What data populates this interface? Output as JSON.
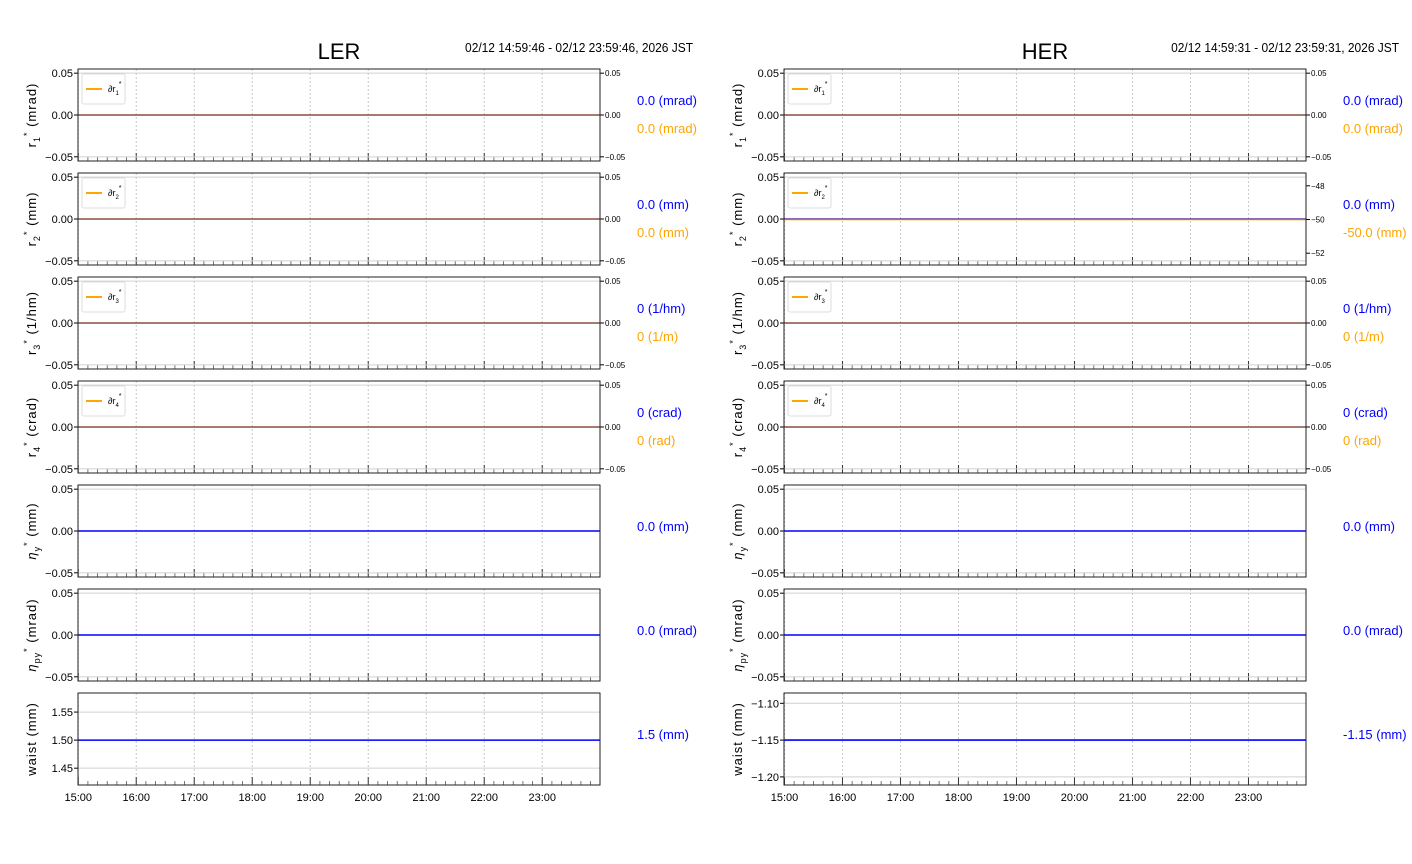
{
  "colors": {
    "blue": "#0000ff",
    "orange": "#ffa500",
    "red_trace": "#d9534f",
    "axis": "#000000",
    "grid": "#c8c8c8"
  },
  "chart_data": [
    {
      "type": "line",
      "title": "LER",
      "time_range_label": "02/12 14:59:46 - 02/12 23:59:46, 2026 JST",
      "x_ticks": [
        "15:00",
        "16:00",
        "17:00",
        "18:00",
        "19:00",
        "20:00",
        "21:00",
        "22:00",
        "23:00"
      ],
      "xlim_hours": [
        14.9961,
        23.9961
      ],
      "panels": [
        {
          "ylabel_main": "r",
          "ylabel_sub": "1",
          "ylabel_unit": " (mrad)",
          "ylim": [
            -0.055,
            0.055
          ],
          "yticks": [
            "0.05",
            "0.00",
            "−0.05"
          ],
          "ytick_values": [
            0.05,
            0,
            -0.05
          ],
          "legend": "∂r",
          "legend_sub": "1",
          "right_ylim": [
            -0.055,
            0.055
          ],
          "right_ticks": [
            "0.05",
            "0.00",
            "−0.05"
          ],
          "right_tick_values": [
            0.05,
            0,
            -0.05
          ],
          "series": [
            {
              "name": "r1*",
              "color": "#0000ff",
              "value": 0.0
            },
            {
              "name": "∂r1*",
              "color": "#ffa500",
              "value": 0.0,
              "axis": "right"
            }
          ],
          "readouts": [
            {
              "text": "0.0 (mrad)",
              "color": "#0000ff"
            },
            {
              "text": "0.0 (mrad)",
              "color": "#ffa500"
            }
          ]
        },
        {
          "ylabel_main": "r",
          "ylabel_sub": "2",
          "ylabel_unit": " (mm)",
          "ylim": [
            -0.055,
            0.055
          ],
          "yticks": [
            "0.05",
            "0.00",
            "−0.05"
          ],
          "ytick_values": [
            0.05,
            0,
            -0.05
          ],
          "legend": "∂r",
          "legend_sub": "2",
          "right_ylim": [
            -0.055,
            0.055
          ],
          "right_ticks": [
            "0.05",
            "0.00",
            "−0.05"
          ],
          "right_tick_values": [
            0.05,
            0,
            -0.05
          ],
          "series": [
            {
              "name": "r2*",
              "color": "#0000ff",
              "value": 0.0
            },
            {
              "name": "∂r2*",
              "color": "#ffa500",
              "value": 0.0,
              "axis": "right"
            }
          ],
          "readouts": [
            {
              "text": "0.0 (mm)",
              "color": "#0000ff"
            },
            {
              "text": "0.0 (mm)",
              "color": "#ffa500"
            }
          ]
        },
        {
          "ylabel_main": "r",
          "ylabel_sub": "3",
          "ylabel_unit": " (1/hm)",
          "ylim": [
            -0.055,
            0.055
          ],
          "yticks": [
            "0.05",
            "0.00",
            "−0.05"
          ],
          "ytick_values": [
            0.05,
            0,
            -0.05
          ],
          "legend": "∂r",
          "legend_sub": "3",
          "right_ylim": [
            -0.055,
            0.055
          ],
          "right_ticks": [
            "0.05",
            "0.00",
            "−0.05"
          ],
          "right_tick_values": [
            0.05,
            0,
            -0.05
          ],
          "series": [
            {
              "name": "r3*",
              "color": "#0000ff",
              "value": 0
            },
            {
              "name": "∂r3*",
              "color": "#ffa500",
              "value": 0,
              "axis": "right"
            }
          ],
          "readouts": [
            {
              "text": "0 (1/hm)",
              "color": "#0000ff"
            },
            {
              "text": "0 (1/m)",
              "color": "#ffa500"
            }
          ]
        },
        {
          "ylabel_main": "r",
          "ylabel_sub": "4",
          "ylabel_unit": " (crad)",
          "ylim": [
            -0.055,
            0.055
          ],
          "yticks": [
            "0.05",
            "0.00",
            "−0.05"
          ],
          "ytick_values": [
            0.05,
            0,
            -0.05
          ],
          "legend": "∂r",
          "legend_sub": "4",
          "right_ylim": [
            -0.055,
            0.055
          ],
          "right_ticks": [
            "0.05",
            "0.00",
            "−0.05"
          ],
          "right_tick_values": [
            0.05,
            0,
            -0.05
          ],
          "series": [
            {
              "name": "r4*",
              "color": "#0000ff",
              "value": 0
            },
            {
              "name": "∂r4*",
              "color": "#ffa500",
              "value": 0,
              "axis": "right"
            }
          ],
          "readouts": [
            {
              "text": "0 (crad)",
              "color": "#0000ff"
            },
            {
              "text": "0 (rad)",
              "color": "#ffa500"
            }
          ]
        },
        {
          "ylabel_main": "η",
          "ylabel_sub": "y",
          "ylabel_unit": " (mm)",
          "ylim": [
            -0.055,
            0.055
          ],
          "yticks": [
            "0.05",
            "0.00",
            "−0.05"
          ],
          "ytick_values": [
            0.05,
            0,
            -0.05
          ],
          "series": [
            {
              "name": "ηy*",
              "color": "#0000ff",
              "value": 0.0
            }
          ],
          "readouts": [
            {
              "text": "0.0 (mm)",
              "color": "#0000ff"
            }
          ]
        },
        {
          "ylabel_main": "η",
          "ylabel_sub": "py",
          "ylabel_unit": " (mrad)",
          "ylim": [
            -0.055,
            0.055
          ],
          "yticks": [
            "0.05",
            "0.00",
            "−0.05"
          ],
          "ytick_values": [
            0.05,
            0,
            -0.05
          ],
          "series": [
            {
              "name": "ηpy*",
              "color": "#0000ff",
              "value": 0.0
            }
          ],
          "readouts": [
            {
              "text": "0.0 (mrad)",
              "color": "#0000ff"
            }
          ]
        },
        {
          "ylabel_main": "waist",
          "ylabel_sub": "",
          "ylabel_unit": " (mm)",
          "ylim": [
            1.42,
            1.584
          ],
          "yticks": [
            "1.55",
            "1.50",
            "1.45"
          ],
          "ytick_values": [
            1.55,
            1.5,
            1.45
          ],
          "series": [
            {
              "name": "waist",
              "color": "#0000ff",
              "value": 1.5
            }
          ],
          "readouts": [
            {
              "text": "1.5 (mm)",
              "color": "#0000ff"
            }
          ]
        }
      ]
    },
    {
      "type": "line",
      "title": "HER",
      "time_range_label": "02/12 14:59:31 - 02/12 23:59:31, 2026 JST",
      "x_ticks": [
        "15:00",
        "16:00",
        "17:00",
        "18:00",
        "19:00",
        "20:00",
        "21:00",
        "22:00",
        "23:00"
      ],
      "xlim_hours": [
        14.9919,
        23.9919
      ],
      "panels": [
        {
          "ylabel_main": "r",
          "ylabel_sub": "1",
          "ylabel_unit": " (mrad)",
          "ylim": [
            -0.055,
            0.055
          ],
          "yticks": [
            "0.05",
            "0.00",
            "−0.05"
          ],
          "ytick_values": [
            0.05,
            0,
            -0.05
          ],
          "legend": "∂r",
          "legend_sub": "1",
          "right_ylim": [
            -0.055,
            0.055
          ],
          "right_ticks": [
            "0.05",
            "0.00",
            "−0.05"
          ],
          "right_tick_values": [
            0.05,
            0,
            -0.05
          ],
          "series": [
            {
              "name": "r1*",
              "color": "#0000ff",
              "value": 0.0
            },
            {
              "name": "∂r1*",
              "color": "#ffa500",
              "value": 0.0,
              "axis": "right"
            }
          ],
          "readouts": [
            {
              "text": "0.0 (mrad)",
              "color": "#0000ff"
            },
            {
              "text": "0.0 (mrad)",
              "color": "#ffa500"
            }
          ]
        },
        {
          "ylabel_main": "r",
          "ylabel_sub": "2",
          "ylabel_unit": " (mm)",
          "ylim": [
            -0.055,
            0.055
          ],
          "yticks": [
            "0.05",
            "0.00",
            "−0.05"
          ],
          "ytick_values": [
            0.05,
            0,
            -0.05
          ],
          "legend": "∂r",
          "legend_sub": "2",
          "right_ylim": [
            -52.7,
            -47.24
          ],
          "right_ticks": [
            "−48",
            "−50",
            "−52"
          ],
          "right_tick_values": [
            -48,
            -50,
            -52
          ],
          "series": [
            {
              "name": "r2*",
              "color": "#0000ff",
              "value": 0.0
            },
            {
              "name": "∂r2*",
              "color": "#ffa500",
              "value": -50.0,
              "axis": "right"
            }
          ],
          "readouts": [
            {
              "text": "0.0 (mm)",
              "color": "#0000ff"
            },
            {
              "text": "-50.0 (mm)",
              "color": "#ffa500"
            }
          ]
        },
        {
          "ylabel_main": "r",
          "ylabel_sub": "3",
          "ylabel_unit": " (1/hm)",
          "ylim": [
            -0.055,
            0.055
          ],
          "yticks": [
            "0.05",
            "0.00",
            "−0.05"
          ],
          "ytick_values": [
            0.05,
            0,
            -0.05
          ],
          "legend": "∂r",
          "legend_sub": "3",
          "right_ylim": [
            -0.055,
            0.055
          ],
          "right_ticks": [
            "0.05",
            "0.00",
            "−0.05"
          ],
          "right_tick_values": [
            0.05,
            0,
            -0.05
          ],
          "series": [
            {
              "name": "r3*",
              "color": "#0000ff",
              "value": 0
            },
            {
              "name": "∂r3*",
              "color": "#ffa500",
              "value": 0,
              "axis": "right"
            }
          ],
          "readouts": [
            {
              "text": "0 (1/hm)",
              "color": "#0000ff"
            },
            {
              "text": "0 (1/m)",
              "color": "#ffa500"
            }
          ]
        },
        {
          "ylabel_main": "r",
          "ylabel_sub": "4",
          "ylabel_unit": " (crad)",
          "ylim": [
            -0.055,
            0.055
          ],
          "yticks": [
            "0.05",
            "0.00",
            "−0.05"
          ],
          "ytick_values": [
            0.05,
            0,
            -0.05
          ],
          "legend": "∂r",
          "legend_sub": "4",
          "right_ylim": [
            -0.055,
            0.055
          ],
          "right_ticks": [
            "0.05",
            "0.00",
            "−0.05"
          ],
          "right_tick_values": [
            0.05,
            0,
            -0.05
          ],
          "series": [
            {
              "name": "r4*",
              "color": "#0000ff",
              "value": 0
            },
            {
              "name": "∂r4*",
              "color": "#ffa500",
              "value": 0,
              "axis": "right"
            }
          ],
          "readouts": [
            {
              "text": "0 (crad)",
              "color": "#0000ff"
            },
            {
              "text": "0 (rad)",
              "color": "#ffa500"
            }
          ]
        },
        {
          "ylabel_main": "η",
          "ylabel_sub": "y",
          "ylabel_unit": " (mm)",
          "ylim": [
            -0.055,
            0.055
          ],
          "yticks": [
            "0.05",
            "0.00",
            "−0.05"
          ],
          "ytick_values": [
            0.05,
            0,
            -0.05
          ],
          "series": [
            {
              "name": "ηy*",
              "color": "#0000ff",
              "value": 0.0
            }
          ],
          "readouts": [
            {
              "text": "0.0 (mm)",
              "color": "#0000ff"
            }
          ]
        },
        {
          "ylabel_main": "η",
          "ylabel_sub": "py",
          "ylabel_unit": " (mrad)",
          "ylim": [
            -0.055,
            0.055
          ],
          "yticks": [
            "0.05",
            "0.00",
            "−0.05"
          ],
          "ytick_values": [
            0.05,
            0,
            -0.05
          ],
          "series": [
            {
              "name": "ηpy*",
              "color": "#0000ff",
              "value": 0.0
            }
          ],
          "readouts": [
            {
              "text": "0.0 (mrad)",
              "color": "#0000ff"
            }
          ]
        },
        {
          "ylabel_main": "waist",
          "ylabel_sub": "",
          "ylabel_unit": " (mm)",
          "ylim": [
            -1.211,
            -1.086
          ],
          "yticks": [
            "−1.10",
            "−1.15",
            "−1.20"
          ],
          "ytick_values": [
            -1.1,
            -1.15,
            -1.2
          ],
          "series": [
            {
              "name": "waist",
              "color": "#0000ff",
              "value": -1.15
            }
          ],
          "readouts": [
            {
              "text": "-1.15 (mm)",
              "color": "#0000ff"
            }
          ]
        }
      ]
    }
  ]
}
